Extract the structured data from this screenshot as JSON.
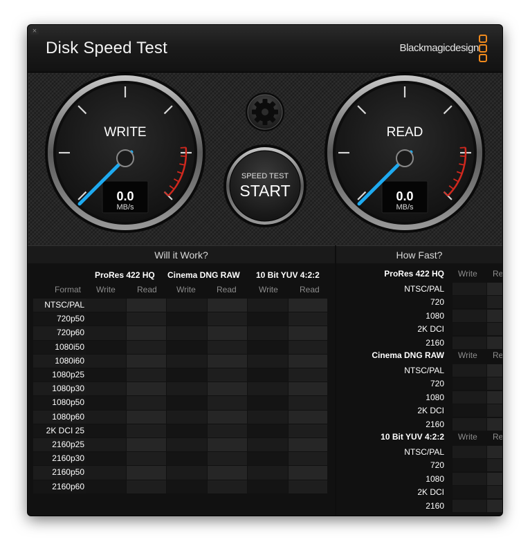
{
  "window": {
    "title": "Disk Speed Test",
    "close_icon": "close-icon",
    "brand": "Blackmagicdesign",
    "brand_logo_icon": "blackmagic-logo-icon",
    "accent_color": "#f08a1d"
  },
  "gauges": {
    "write": {
      "label": "WRITE",
      "value": "0.0",
      "unit": "MB/s",
      "needle_color": "#1eaaf0"
    },
    "read": {
      "label": "READ",
      "value": "0.0",
      "unit": "MB/s",
      "needle_color": "#1eaaf0"
    },
    "redline_color": "#d0281e"
  },
  "settings_icon": "gear-icon",
  "start_button": {
    "top_label": "SPEED TEST",
    "label": "START"
  },
  "will_it_work": {
    "title": "Will it Work?",
    "format_label": "Format",
    "codecs": [
      "ProRes 422 HQ",
      "Cinema DNG RAW",
      "10 Bit YUV 4:2:2"
    ],
    "write_label": "Write",
    "read_label": "Read",
    "formats": [
      "NTSC/PAL",
      "720p50",
      "720p60",
      "1080i50",
      "1080i60",
      "1080p25",
      "1080p30",
      "1080p50",
      "1080p60",
      "2K DCI 25",
      "2160p25",
      "2160p30",
      "2160p50",
      "2160p60"
    ]
  },
  "how_fast": {
    "title": "How Fast?",
    "write_label": "Write",
    "read_label": "Read",
    "groups": [
      {
        "codec": "ProRes 422 HQ",
        "rows": [
          "NTSC/PAL",
          "720",
          "1080",
          "2K DCI",
          "2160"
        ]
      },
      {
        "codec": "Cinema DNG RAW",
        "rows": [
          "NTSC/PAL",
          "720",
          "1080",
          "2K DCI",
          "2160"
        ]
      },
      {
        "codec": "10 Bit YUV 4:2:2",
        "rows": [
          "NTSC/PAL",
          "720",
          "1080",
          "2K DCI",
          "2160"
        ]
      }
    ]
  }
}
